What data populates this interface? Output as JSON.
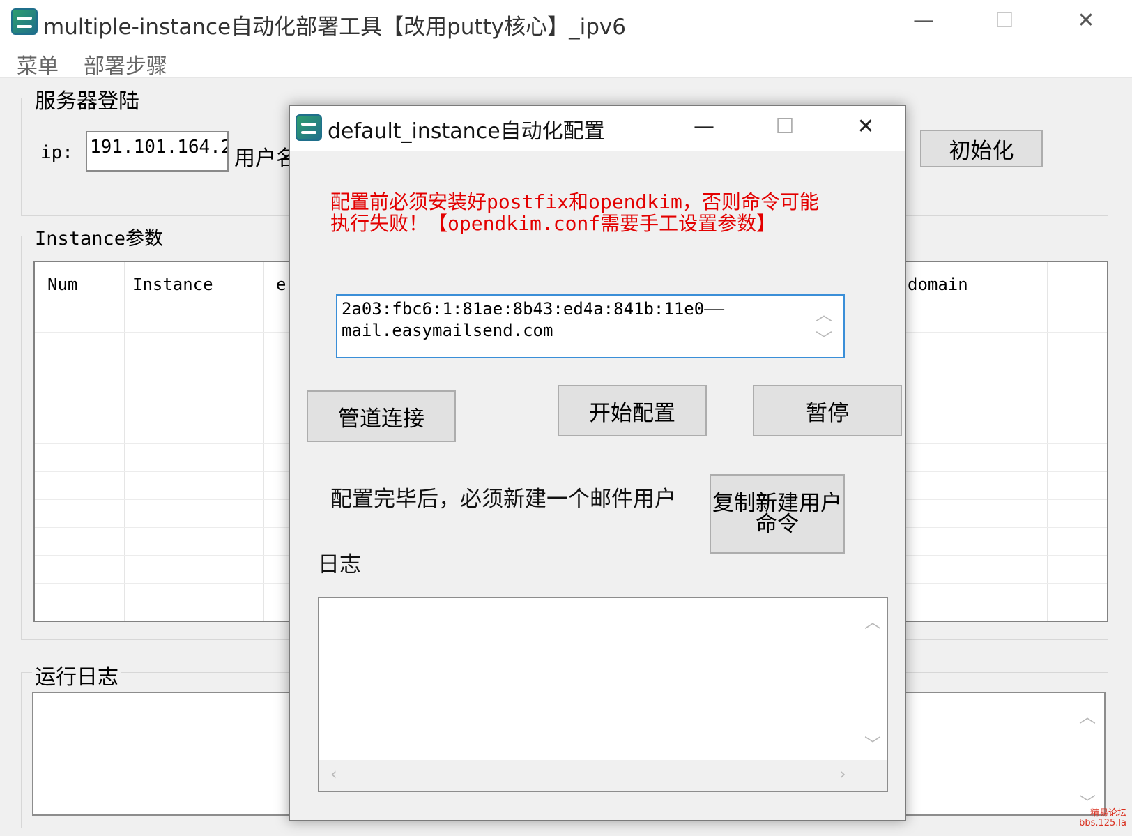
{
  "main_window": {
    "title": "multiple-instance自动化部署工具【改用putty核心】_ipv6",
    "controls": {
      "minimize": "—",
      "maximize": "☐",
      "close": "✕"
    },
    "menu": [
      "菜单",
      "部署步骤"
    ],
    "server_login": {
      "legend": "服务器登陆",
      "ip_label": "ip:",
      "ip_value": "191.101.164.2",
      "user_label": "用户名",
      "init_button": "初始化"
    },
    "instance_params": {
      "legend": "Instance参数",
      "columns": [
        "Num",
        "Instance",
        "e",
        "domain"
      ]
    },
    "run_log": {
      "legend": "运行日志"
    }
  },
  "dialog": {
    "title": "default_instance自动化配置",
    "controls": {
      "minimize": "—",
      "maximize": "☐",
      "close": "✕"
    },
    "warning_line1": "配置前必须安装好postfix和opendkim，否则命令可能",
    "warning_line2": "执行失败！【opendkim.conf需要手工设置参数】",
    "address_line1": "2a03:fbc6:1:81ae:8b43:ed4a:841b:11e0——",
    "address_line2": "mail.easymailsend.com",
    "pipe_connect_button": "管道连接",
    "start_config_button": "开始配置",
    "pause_button": "暂停",
    "after_config_note": "配置完毕后，必须新建一个邮件用户",
    "copy_cmd_button_line1": "复制新建用户",
    "copy_cmd_button_line2": "命令",
    "log_label": "日志"
  },
  "watermark": {
    "line1": "精易论坛",
    "line2": "bbs.125.la"
  }
}
